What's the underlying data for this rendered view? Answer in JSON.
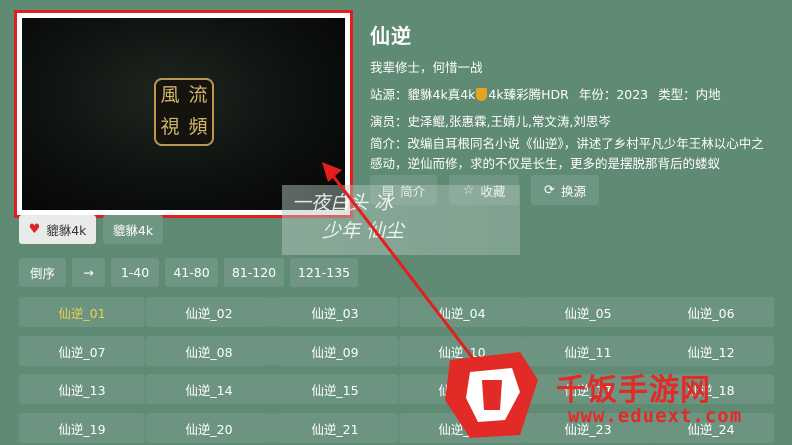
{
  "player": {
    "seal_chars": [
      "風",
      "流",
      "視",
      "頻"
    ]
  },
  "info": {
    "title": "仙逆",
    "subtitle": "我辈修士，何惜一战",
    "site_label": "站源：",
    "site_value_a": "貔貅4k真4k",
    "site_value_b": "4k臻彩腾HDR",
    "year_label": "年份：",
    "year_value": "2023",
    "type_label": "类型：",
    "type_value": "内地",
    "cast_label": "演员：",
    "cast_value": "史泽鲲,张惠霖,王婧儿,常文涛,刘思岑",
    "desc_label": "简介：",
    "desc_value": "改编自耳根同名小说《仙逆》，讲述了乡村平凡少年王林以心中之感动，逆仙而修，求的不仅是长生，更多的是摆脱那背后的蝼蚁"
  },
  "actions": {
    "intro": "简介",
    "favorite": "收藏",
    "switch_source": "换源"
  },
  "sources": [
    "貔貅4k",
    "貔貅4k"
  ],
  "ranges": [
    "倒序",
    "→",
    "1-40",
    "41-80",
    "81-120",
    "121-135"
  ],
  "episodes": [
    "仙逆_01",
    "仙逆_02",
    "仙逆_03",
    "仙逆_04",
    "仙逆_05",
    "仙逆_06",
    "仙逆_07",
    "仙逆_08",
    "仙逆_09",
    "仙逆_10",
    "仙逆_11",
    "仙逆_12",
    "仙逆_13",
    "仙逆_14",
    "仙逆_15",
    "仙逆_16",
    "仙逆_17",
    "仙逆_18",
    "仙逆_19",
    "仙逆_20",
    "仙逆_21",
    "仙逆_22",
    "仙逆_23",
    "仙逆_24"
  ],
  "overlay": {
    "handwriting_line1": "一夜白头 冰",
    "handwriting_line2": "少年 仙尘",
    "watermark_name": "千饭手游网",
    "watermark_url": "www.eduext.com"
  },
  "colors": {
    "accent_red": "#e41d1d",
    "current_episode": "#e7d24f",
    "background": "#5f8a73"
  }
}
